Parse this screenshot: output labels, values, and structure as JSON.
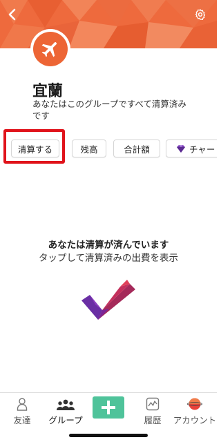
{
  "header": {
    "banner_color": "#ee6a3d",
    "back_icon": "chevron-left-icon",
    "settings_icon": "gear-icon"
  },
  "group": {
    "avatar_icon": "airplane-icon",
    "name": "宜蘭",
    "status": "あなたはこのグループですべて清算済みです"
  },
  "actions": {
    "settle_label": "清算する",
    "balances_label": "残高",
    "totals_label": "合計額",
    "charts_label": "チャート",
    "highlight_color": "#e0131b"
  },
  "empty_state": {
    "title": "あなたは清算が済んでいます",
    "subtitle": "タップして清算済みの出費を表示"
  },
  "tabbar": {
    "friends_label": "友達",
    "groups_label": "グループ",
    "activity_label": "履歴",
    "account_label": "アカウント",
    "add_color": "#4fc39a"
  }
}
